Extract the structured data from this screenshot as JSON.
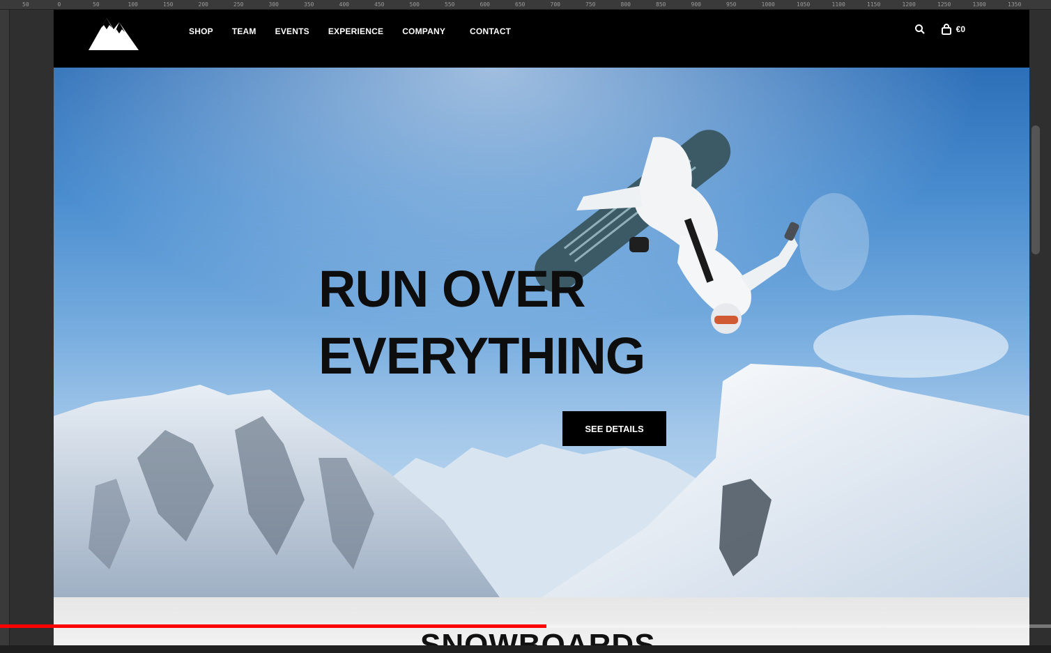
{
  "ruler": {
    "ticks": [
      "50",
      "0",
      "50",
      "100",
      "150",
      "200",
      "250",
      "300",
      "350",
      "400",
      "450",
      "500",
      "550",
      "600",
      "650",
      "700",
      "750",
      "800",
      "850",
      "900",
      "950",
      "1000",
      "1050",
      "1100",
      "1150",
      "1200",
      "1250",
      "1300",
      "1350"
    ]
  },
  "nav": {
    "items": [
      {
        "label": "SHOP"
      },
      {
        "label": "TEAM"
      },
      {
        "label": "EVENTS"
      },
      {
        "label": "EXPERIENCE"
      },
      {
        "label": "COMPANY"
      },
      {
        "label": "CONTACT"
      }
    ],
    "cart_total": "€0"
  },
  "hero": {
    "line1": "RUN OVER",
    "line2": "EVERYTHING",
    "cta_label": "SEE DETAILS"
  },
  "section": {
    "title": "SNOWBOARDS"
  },
  "player": {
    "progress": 0.52
  },
  "colors": {
    "nav_bg": "#000000",
    "accent_red": "#ff0000",
    "cta_bg": "#000000"
  }
}
